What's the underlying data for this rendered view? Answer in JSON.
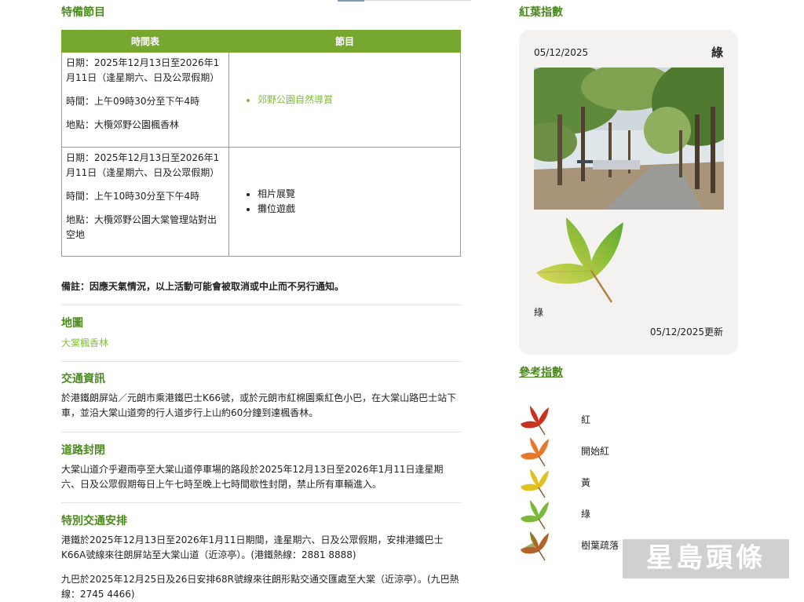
{
  "special_program": {
    "title": "特備節目",
    "table": {
      "headers": [
        "時間表",
        "節目"
      ],
      "rows": [
        {
          "date": "日期：2025年12月13日至2026年1月11日（逢星期六、日及公眾假期）",
          "time": "時間：上午09時30分至下午4時",
          "venue": "地點：大欖郊野公園楓香林",
          "items": [
            "郊野公園自然導賞"
          ]
        },
        {
          "date": "日期：2025年12月13日至2026年1月11日（逢星期六、日及公眾假期）",
          "time": "時間：上午10時30分至下午4時",
          "venue": "地點：大欖郊野公園大棠管理站對出空地",
          "items": [
            "相片展覽",
            "攤位遊戲"
          ]
        }
      ]
    },
    "note": "備註：因應天氣情況，以上活動可能會被取消或中止而不另行通知。"
  },
  "map": {
    "title": "地圖",
    "link": "大棠楓香林"
  },
  "transport": {
    "title": "交通資訊",
    "text": "於港鐵朗屏站／元朗市乘港鐵巴士K66號，或於元朗市紅棉園乘紅色小巴，在大棠山路巴士站下車，並沿大棠山道旁的行人道步行上山約60分鐘到達楓香林。"
  },
  "road_closure": {
    "title": "道路封閉",
    "text": "大棠山道介乎避雨亭至大棠山道停車場的路段於2025年12月13日至2026年1月11日逢星期六、日及公眾假期每日上午七時至晚上七時間歇性封閉，禁止所有車輛進入。"
  },
  "special_transport": {
    "title": "特別交通安排",
    "p1": "港鐵於2025年12月13日至2026年1月11日期間，逢星期六、日及公眾假期，安排港鐵巴士K66A號線來往朗屏站至大棠山道（近涼亭）。(港鐵熱線：2881 8888)",
    "p2": "九巴於2025年12月25日及26日安排68R號線來往朗形點交通交匯處至大棠（近涼亭）。(九巴熱線：2745 4466)"
  },
  "red_leaf_index": {
    "title": "紅葉指數",
    "date": "05/12/2025",
    "status": "綠",
    "caption": "綠",
    "updated": "05/12/2025更新"
  },
  "reference_index": {
    "title": "參考指數",
    "items": [
      {
        "label": "紅",
        "icon": "red-leaf-icon"
      },
      {
        "label": "開始紅",
        "icon": "orange-leaf-icon"
      },
      {
        "label": "黃",
        "icon": "yellow-leaf-icon"
      },
      {
        "label": "綠",
        "icon": "green-leaf-icon"
      },
      {
        "label": "樹葉疏落",
        "icon": "sparse-leaf-icon"
      }
    ]
  },
  "watermark": "星島頭條",
  "colors": {
    "accent_green": "#4b8a1c",
    "header_green": "#76a72f",
    "link_green": "#7fbf3a",
    "card_bg": "#f3f2f0"
  }
}
